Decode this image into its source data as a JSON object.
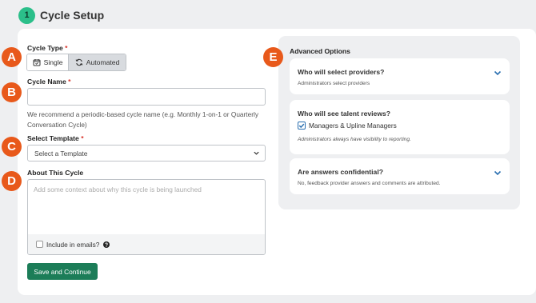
{
  "header": {
    "step_number": "1",
    "title": "Cycle Setup"
  },
  "cycle_type": {
    "label": "Cycle Type",
    "required_mark": "*",
    "options": [
      {
        "label": "Single",
        "icon": "calendar-icon",
        "selected": false
      },
      {
        "label": "Automated",
        "icon": "sync-icon",
        "selected": true
      }
    ]
  },
  "cycle_name": {
    "label": "Cycle Name",
    "required_mark": "*",
    "value": "",
    "hint": "We recommend a periodic-based cycle name (e.g. Monthly 1-on-1 or Quarterly Conversation Cycle)"
  },
  "template": {
    "label": "Select Template",
    "required_mark": "*",
    "selected": "Select a Template"
  },
  "about": {
    "label": "About This Cycle",
    "placeholder": "Add some context about why this cycle is being launched",
    "include_label": "Include in emails?",
    "include_checked": false
  },
  "save_button": "Save and Continue",
  "advanced": {
    "title": "Advanced Options",
    "cards": [
      {
        "title": "Who will select providers?",
        "subtitle": "Administrators select providers"
      },
      {
        "title": "Who will see talent reviews?",
        "checkbox_label": "Managers & Upline Managers",
        "checked": true,
        "note": "Administrators always have visibility to reporting."
      },
      {
        "title": "Are answers confidential?",
        "subtitle": "No, feedback provider answers and comments are attributed."
      }
    ]
  },
  "callouts": [
    "A",
    "B",
    "C",
    "D",
    "E"
  ],
  "colors": {
    "accent": "#1c7d58",
    "badge": "#2bbf8a",
    "callout": "#e8591b",
    "link": "#2a6fb0",
    "required": "#d9342b"
  }
}
